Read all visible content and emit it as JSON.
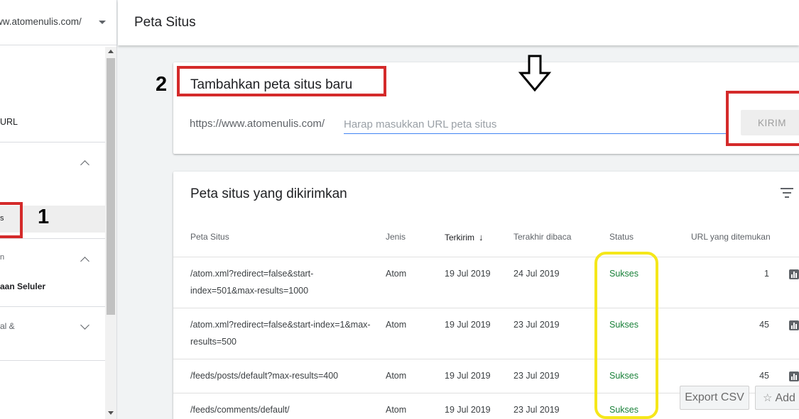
{
  "sidebar": {
    "property_url": "ww.atomenulis.com/",
    "items": [
      {
        "label": "URL"
      },
      {
        "label": "s"
      },
      {
        "label": "n"
      },
      {
        "label": "aan Seluler"
      },
      {
        "label": "al &"
      }
    ]
  },
  "header": {
    "title": "Peta Situs"
  },
  "add_sitemap": {
    "title": "Tambahkan peta situs baru",
    "url_prefix": "https://www.atomenulis.com/",
    "input_placeholder": "Harap masukkan URL peta situs",
    "input_value": "",
    "submit_label": "KIRIM"
  },
  "submitted": {
    "title": "Peta situs yang dikirimkan",
    "columns": {
      "sitemap": "Peta Situs",
      "type": "Jenis",
      "submitted": "Terkirim",
      "last_read": "Terakhir dibaca",
      "status": "Status",
      "urls_found": "URL yang ditemukan"
    },
    "sort_icon": "arrow-down-icon",
    "rows": [
      {
        "path": "/atom.xml?redirect=false&start-index=501&max-results=1000",
        "type": "Atom",
        "submitted": "19 Jul 2019",
        "last_read": "24 Jul 2019",
        "status": "Sukses",
        "urls": "1"
      },
      {
        "path": "/atom.xml?redirect=false&start-index=1&max-results=500",
        "type": "Atom",
        "submitted": "19 Jul 2019",
        "last_read": "23 Jul 2019",
        "status": "Sukses",
        "urls": "45"
      },
      {
        "path": "/feeds/posts/default?max-results=400",
        "type": "Atom",
        "submitted": "19 Jul 2019",
        "last_read": "23 Jul 2019",
        "status": "Sukses",
        "urls": "45"
      },
      {
        "path": "/feeds/comments/default/",
        "type": "Atom",
        "submitted": "19 Jul 2019",
        "last_read": "23 Jul 2019",
        "status": "Sukses",
        "urls": ""
      }
    ]
  },
  "floating": {
    "export_label": "Export CSV",
    "add_label": "Add"
  },
  "annotations": {
    "one": "1",
    "two": "2"
  },
  "colors": {
    "accent": "#4285f4",
    "success": "#188038",
    "highlight_red": "#d42a2a",
    "highlight_yellow": "#f5e71a"
  }
}
